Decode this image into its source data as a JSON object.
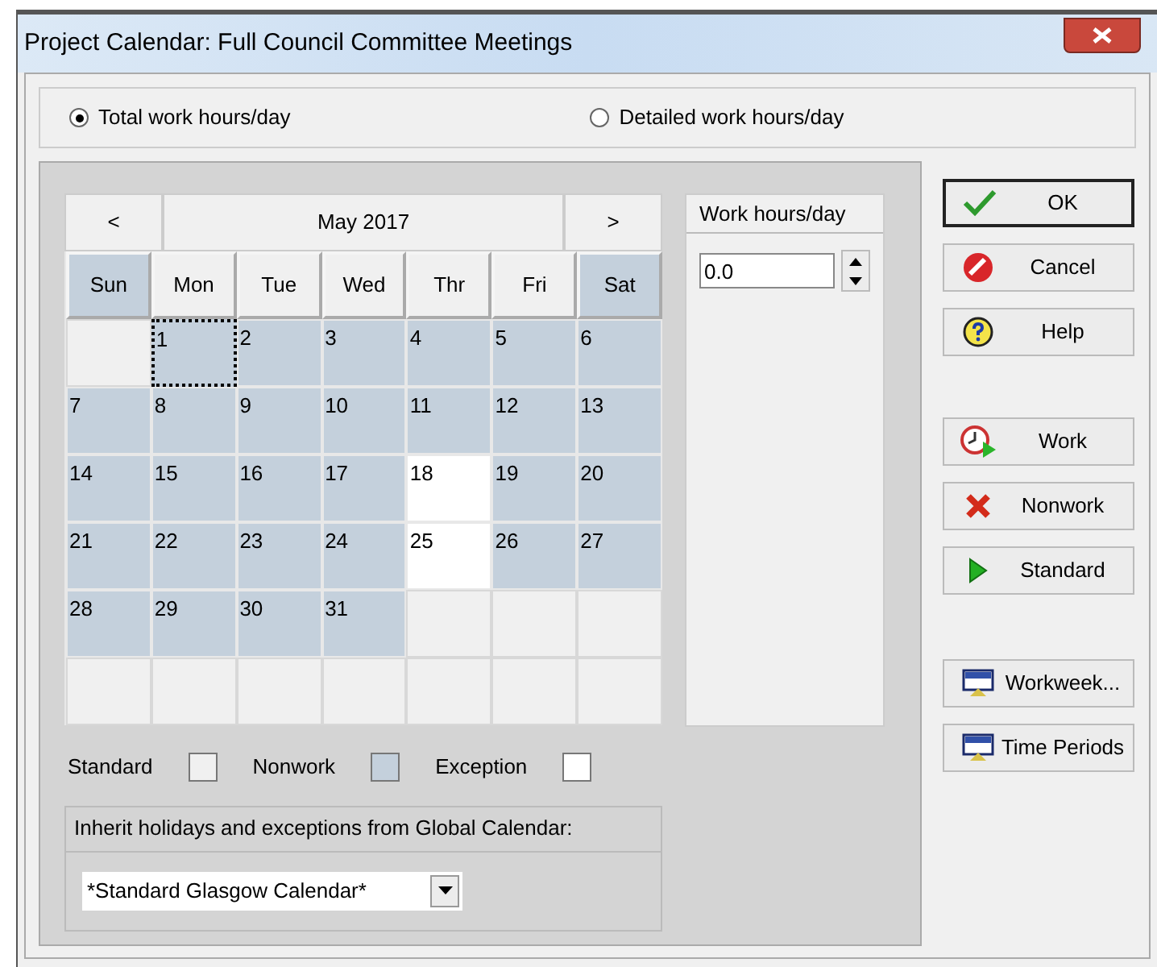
{
  "window": {
    "title": "Project Calendar: Full Council Committee Meetings"
  },
  "mode_options": [
    {
      "label": "Total work hours/day",
      "selected": true
    },
    {
      "label": "Detailed work hours/day",
      "selected": false
    }
  ],
  "calendar": {
    "prev": "<",
    "month": "May 2017",
    "next": ">",
    "weekdays": [
      {
        "label": "Sun",
        "kind": "nonwork"
      },
      {
        "label": "Mon",
        "kind": "standard"
      },
      {
        "label": "Tue",
        "kind": "standard"
      },
      {
        "label": "Wed",
        "kind": "standard"
      },
      {
        "label": "Thr",
        "kind": "standard"
      },
      {
        "label": "Fri",
        "kind": "standard"
      },
      {
        "label": "Sat",
        "kind": "nonwork"
      }
    ],
    "days": [
      {
        "kind": "empty"
      },
      {
        "day": "1",
        "kind": "nonwork",
        "selected": true
      },
      {
        "day": "2",
        "kind": "nonwork",
        "selected": false
      },
      {
        "day": "3",
        "kind": "nonwork",
        "selected": false
      },
      {
        "day": "4",
        "kind": "nonwork",
        "selected": false
      },
      {
        "day": "5",
        "kind": "nonwork",
        "selected": false
      },
      {
        "day": "6",
        "kind": "nonwork",
        "selected": false
      },
      {
        "day": "7",
        "kind": "nonwork",
        "selected": false
      },
      {
        "day": "8",
        "kind": "nonwork",
        "selected": false
      },
      {
        "day": "9",
        "kind": "nonwork",
        "selected": false
      },
      {
        "day": "10",
        "kind": "nonwork",
        "selected": false
      },
      {
        "day": "11",
        "kind": "nonwork",
        "selected": false
      },
      {
        "day": "12",
        "kind": "nonwork",
        "selected": false
      },
      {
        "day": "13",
        "kind": "nonwork",
        "selected": false
      },
      {
        "day": "14",
        "kind": "nonwork",
        "selected": false
      },
      {
        "day": "15",
        "kind": "nonwork",
        "selected": false
      },
      {
        "day": "16",
        "kind": "nonwork",
        "selected": false
      },
      {
        "day": "17",
        "kind": "nonwork",
        "selected": false
      },
      {
        "day": "18",
        "kind": "exception",
        "selected": false
      },
      {
        "day": "19",
        "kind": "nonwork",
        "selected": false
      },
      {
        "day": "20",
        "kind": "nonwork",
        "selected": false
      },
      {
        "day": "21",
        "kind": "nonwork",
        "selected": false
      },
      {
        "day": "22",
        "kind": "nonwork",
        "selected": false
      },
      {
        "day": "23",
        "kind": "nonwork",
        "selected": false
      },
      {
        "day": "24",
        "kind": "nonwork",
        "selected": false
      },
      {
        "day": "25",
        "kind": "exception",
        "selected": false
      },
      {
        "day": "26",
        "kind": "nonwork",
        "selected": false
      },
      {
        "day": "27",
        "kind": "nonwork",
        "selected": false
      },
      {
        "day": "28",
        "kind": "nonwork",
        "selected": false
      },
      {
        "day": "29",
        "kind": "nonwork",
        "selected": false
      },
      {
        "day": "30",
        "kind": "nonwork",
        "selected": false
      },
      {
        "day": "31",
        "kind": "nonwork",
        "selected": false
      },
      {
        "kind": "empty"
      },
      {
        "kind": "empty"
      },
      {
        "kind": "empty"
      },
      {
        "kind": "empty"
      },
      {
        "kind": "empty"
      },
      {
        "kind": "empty"
      },
      {
        "kind": "empty"
      },
      {
        "kind": "empty"
      },
      {
        "kind": "empty"
      },
      {
        "kind": "empty"
      }
    ]
  },
  "work_hours": {
    "title": "Work hours/day",
    "value": "0.0"
  },
  "legend": [
    {
      "label": "Standard",
      "kind": "standard"
    },
    {
      "label": "Nonwork",
      "kind": "nonwork"
    },
    {
      "label": "Exception",
      "kind": "exception"
    }
  ],
  "inherit": {
    "title": "Inherit holidays and exceptions from Global Calendar:",
    "value": "*Standard Glasgow Calendar*"
  },
  "buttons": [
    {
      "label": "OK",
      "kind": "ok",
      "default": true
    },
    {
      "label": "Cancel",
      "kind": "cancel",
      "default": false
    },
    {
      "label": "Help",
      "kind": "help",
      "default": false
    },
    {
      "label": "Work",
      "kind": "work",
      "default": false
    },
    {
      "label": "Nonwork",
      "kind": "nonwork",
      "default": false
    },
    {
      "label": "Standard",
      "kind": "standard",
      "default": false
    },
    {
      "label": "Workweek...",
      "kind": "screen",
      "default": false
    },
    {
      "label": "Time Periods",
      "kind": "screen",
      "default": false
    }
  ]
}
